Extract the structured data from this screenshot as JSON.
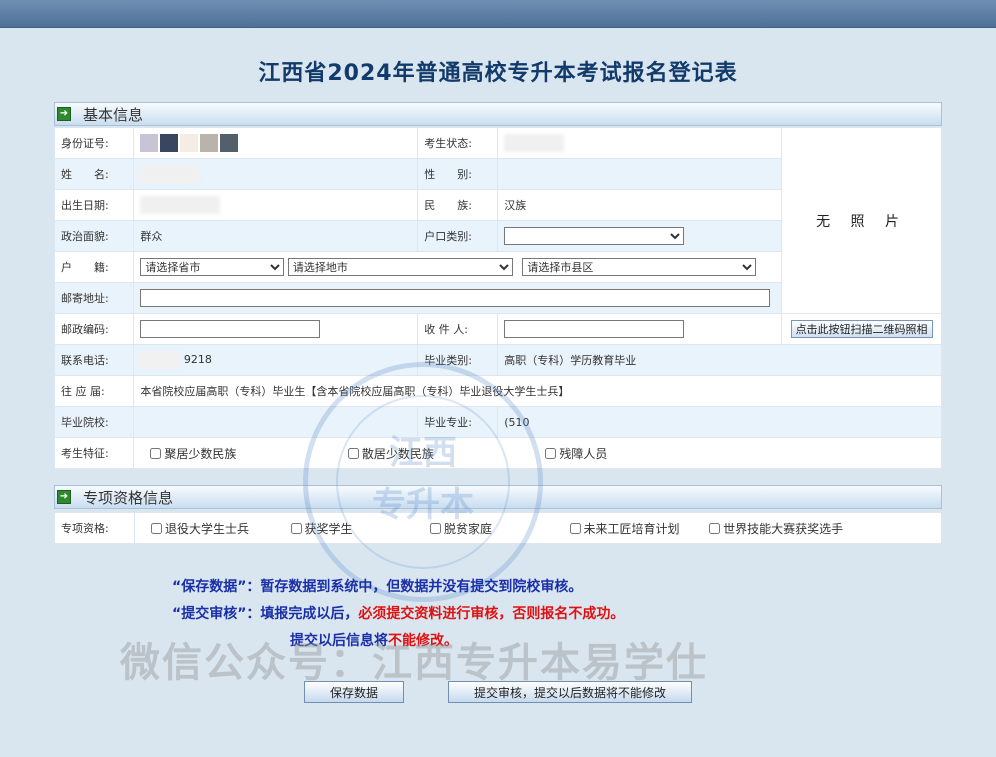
{
  "page_title": "江西省2024年普通高校专升本考试报名登记表",
  "basic_section": {
    "title": "基本信息",
    "icon": "arrow-right-icon"
  },
  "fields": {
    "id_number": {
      "label": "身份证号:"
    },
    "exam_status": {
      "label": "考生状态:"
    },
    "name": {
      "label": "姓　　名:"
    },
    "gender": {
      "label": "性　　别:"
    },
    "birth_date": {
      "label": "出生日期:"
    },
    "ethnicity": {
      "label": "民　　族:",
      "value": "汉族"
    },
    "politics": {
      "label": "政治面貌:",
      "value": "群众"
    },
    "hukou_type": {
      "label": "户口类别:",
      "value": ""
    },
    "native_place": {
      "label": "户　　籍:",
      "province": "请选择省市",
      "city": "请选择地市",
      "county": "请选择市县区"
    },
    "mail_address": {
      "label": "邮寄地址:",
      "value": ""
    },
    "postal_code": {
      "label": "邮政编码:",
      "value": ""
    },
    "recipient": {
      "label": "收 件 人:",
      "value": ""
    },
    "phone": {
      "label": "联系电话:",
      "value": "9218"
    },
    "grad_category": {
      "label": "毕业类别:",
      "value": "高职（专科）学历教育毕业"
    },
    "grad_level": {
      "label": "往 应 届:",
      "value": "本省院校应届高职（专科）毕业生【含本省院校应届高职（专科）毕业退役大学生士兵】"
    },
    "grad_school": {
      "label": "毕业院校:",
      "value": ""
    },
    "grad_major": {
      "label": "毕业专业:",
      "value": "(510"
    },
    "features": {
      "label": "考生特征:",
      "options": [
        "聚居少数民族",
        "散居少数民族",
        "残障人员"
      ]
    }
  },
  "photo": {
    "text": "无 照 片",
    "qr_button": "点击此按钮扫描二维码照相"
  },
  "special_section": {
    "title": "专项资格信息",
    "icon": "arrow-right-icon",
    "label": "专项资格:",
    "options": [
      "退役大学生士兵",
      "获奖学生",
      "脱贫家庭",
      "未来工匠培育计划",
      "世界技能大赛获奖选手"
    ]
  },
  "notes": {
    "save_label": "“保存数据”：",
    "save_text": "暂存数据到系统中，但数据并没有提交到院校审核。",
    "submit_label": "“提交审核”：",
    "submit_text_1": "填报完成以后，",
    "submit_text_2": "必须提交资料进行审核，否则报名不成功。",
    "after_text_1": "提交以后信息将",
    "after_text_2": "不能修改。"
  },
  "watermark": {
    "text": "微信公众号：江西专升本易学仕",
    "seal_line1": "江西",
    "seal_line2": "专升本"
  },
  "buttons": {
    "save": "保存数据",
    "submit": "提交审核，提交以后数据将不能修改"
  },
  "colors": {
    "title": "#123a6b",
    "notes_blue": "#1a2fa8",
    "notes_red": "#e01010",
    "topbar": "#5a7ca3"
  }
}
